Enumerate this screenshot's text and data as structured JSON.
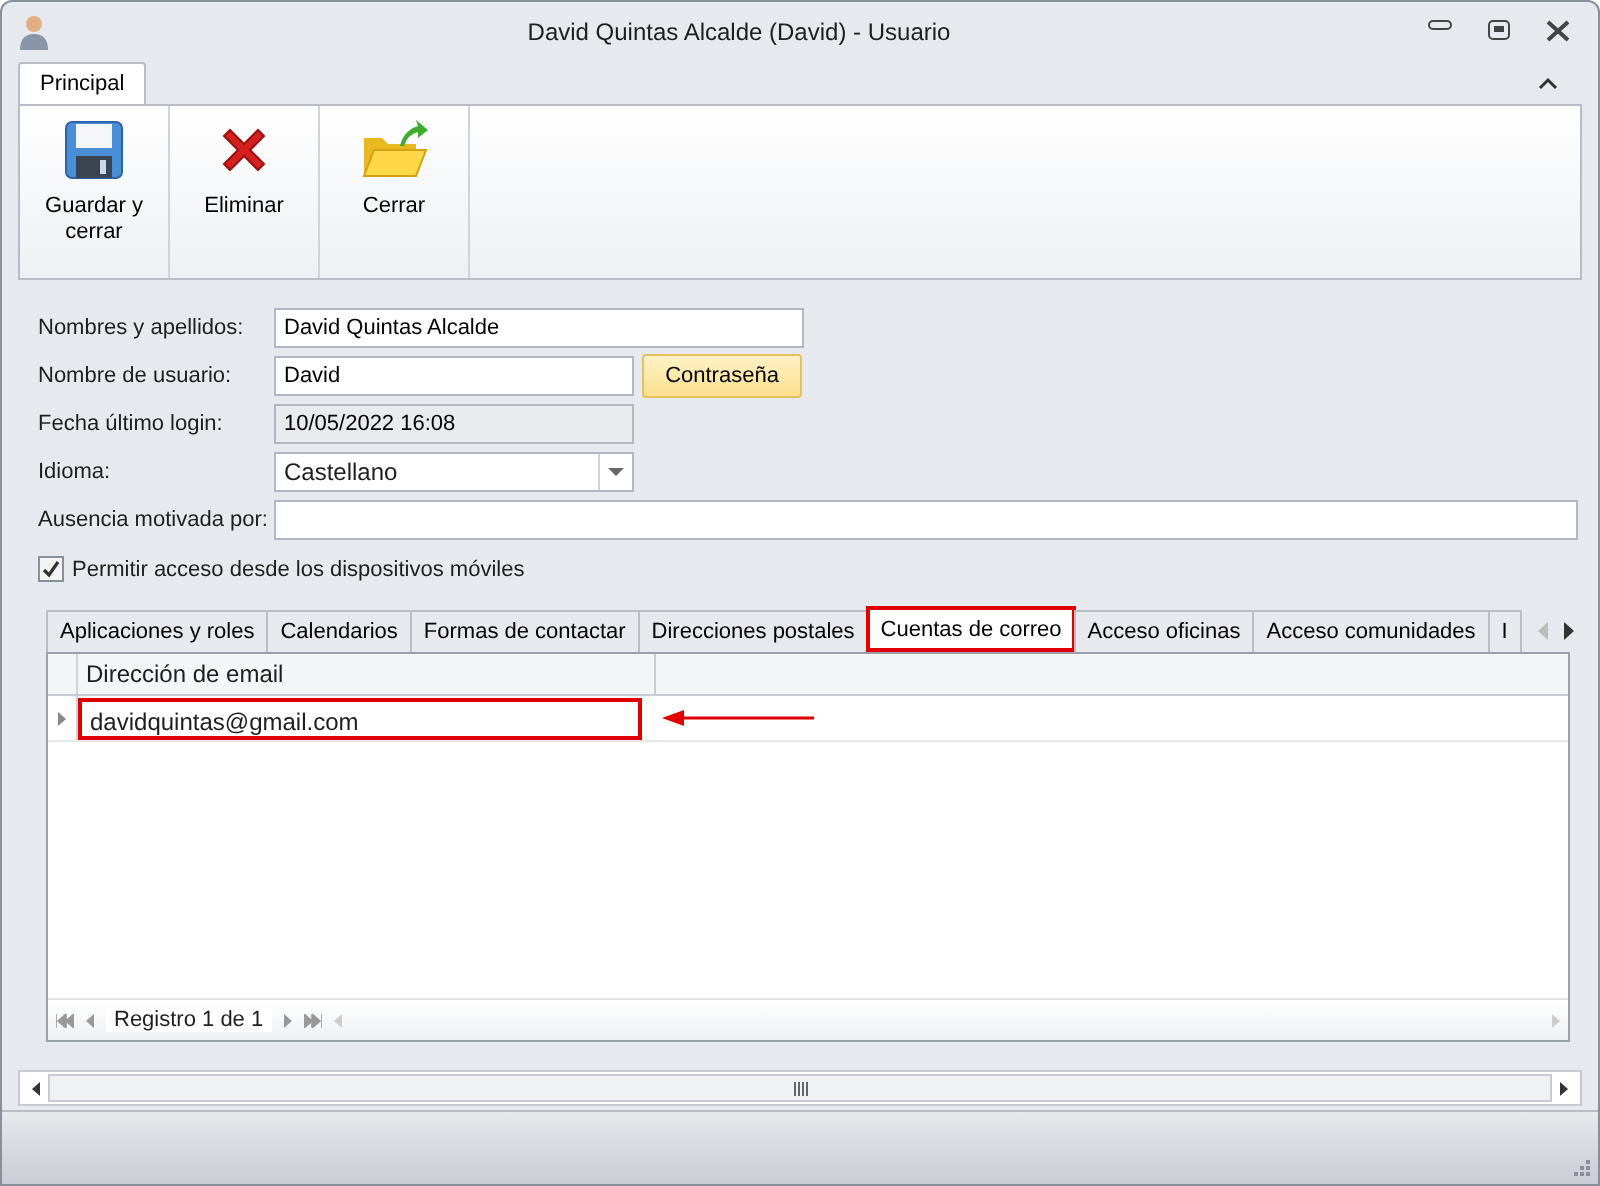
{
  "window": {
    "title": "David Quintas Alcalde (David) - Usuario"
  },
  "ribbon": {
    "tabs": [
      {
        "label": "Principal",
        "selected": true
      }
    ],
    "buttons": [
      {
        "label": "Guardar y cerrar",
        "kind": "save"
      },
      {
        "label": "Eliminar",
        "kind": "delete"
      },
      {
        "label": "Cerrar",
        "kind": "close"
      }
    ]
  },
  "form": {
    "fields": [
      {
        "label": "Nombres y apellidos:",
        "value": "David Quintas Alcalde",
        "kind": "text"
      },
      {
        "label": "Nombre de usuario:",
        "value": "David",
        "kind": "text",
        "button": "Contraseña"
      },
      {
        "label": "Fecha último login:",
        "value": "10/05/2022 16:08",
        "kind": "readonly"
      },
      {
        "label": "Idioma:",
        "value": "Castellano",
        "kind": "combo"
      },
      {
        "label": "Ausencia motivada por:",
        "kind": "text"
      }
    ],
    "checkbox": {
      "label": "Permitir acceso desde los dispositivos móviles",
      "checked": true
    }
  },
  "tabs": [
    {
      "label": "Aplicaciones y roles",
      "selected": false,
      "highlighted": false
    },
    {
      "label": "Calendarios",
      "selected": false,
      "highlighted": false
    },
    {
      "label": "Formas de contactar",
      "selected": false,
      "highlighted": false
    },
    {
      "label": "Direcciones postales",
      "selected": false,
      "highlighted": false
    },
    {
      "label": "Cuentas de correo",
      "selected": true,
      "highlighted": true
    },
    {
      "label": "Acceso oficinas",
      "selected": false,
      "highlighted": false
    },
    {
      "label": "Acceso comunidades",
      "selected": false,
      "highlighted": false
    },
    {
      "label": "I",
      "selected": false,
      "highlighted": false
    }
  ],
  "table": {
    "columns": [
      "Dirección de email"
    ],
    "rows": [
      {
        "cells": [
          "davidquintas@gmail.com"
        ],
        "highlighted": true
      }
    ],
    "navigator": "Registro 1 de 1"
  }
}
